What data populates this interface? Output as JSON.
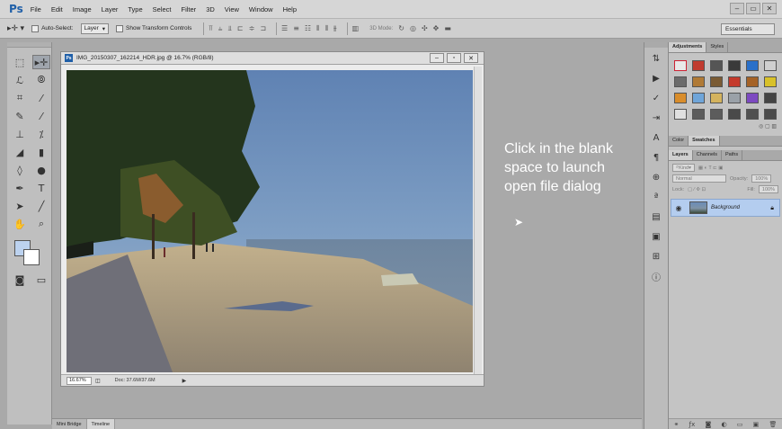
{
  "menubar": {
    "logo": "Ps",
    "items": [
      "File",
      "Edit",
      "Image",
      "Layer",
      "Type",
      "Select",
      "Filter",
      "3D",
      "View",
      "Window",
      "Help"
    ],
    "min": "–",
    "max": "▭",
    "close": "✕"
  },
  "options": {
    "auto_select_label": "Auto-Select:",
    "auto_select_value": "Layer",
    "show_transform_label": "Show Transform Controls",
    "three_d_mode_label": "3D Mode:",
    "workspace": "Essentials"
  },
  "document": {
    "title": "IMG_20150307_162214_HDR.jpg @ 16.7% (RGB/8)",
    "zoom": "16.67%",
    "doc_info": "Doc: 37.6M/37.6M",
    "badge": "Ps"
  },
  "callout": {
    "line1": "Click in the blank",
    "line2": "space to launch",
    "line3": "open file dialog"
  },
  "bottom_tabs": [
    "Mini Bridge",
    "Timeline"
  ],
  "panels": {
    "adjust_tabs": [
      "Adjustments",
      "Styles"
    ],
    "color_tabs": [
      "Color",
      "Swatches"
    ],
    "layers_tabs": [
      "Layers",
      "Channels",
      "Paths"
    ],
    "kind_label": "Kind",
    "blend_mode": "Normal",
    "opacity_label": "Opacity:",
    "opacity_value": "100%",
    "lock_label": "Lock:",
    "fill_label": "Fill:",
    "fill_value": "100%",
    "layer_name": "Background"
  },
  "colors": {
    "foreground": "#bcd2ef",
    "background": "#ffffff",
    "selected_layer": "#b4cdef"
  }
}
